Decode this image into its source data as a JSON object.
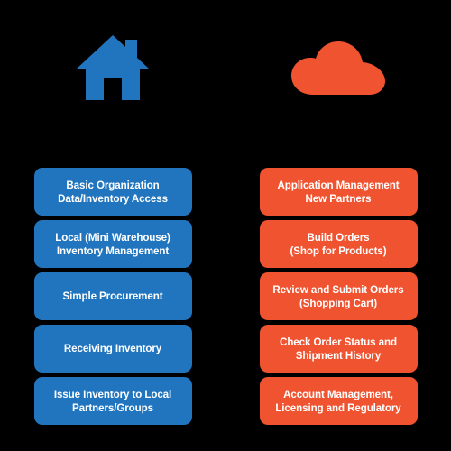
{
  "diagram": {
    "background_color": "#000000",
    "columns": [
      {
        "id": "local-column",
        "icon": "house-icon",
        "icon_color": "#2175bf",
        "box_color": "#2175bf",
        "text_color": "#ffffff",
        "boxes": [
          {
            "label": "Basic Organization\nData/Inventory Access"
          },
          {
            "label": "Local (Mini Warehouse)\nInventory Management"
          },
          {
            "label": "Simple Procurement"
          },
          {
            "label": "Receiving Inventory"
          },
          {
            "label": "Issue Inventory to Local\nPartners/Groups"
          }
        ]
      },
      {
        "id": "cloud-column",
        "icon": "cloud-icon",
        "icon_color": "#ef5330",
        "box_color": "#ef5330",
        "text_color": "#ffffff",
        "boxes": [
          {
            "label": "Application Management\nNew Partners"
          },
          {
            "label": "Build Orders\n(Shop for Products)"
          },
          {
            "label": "Review and Submit Orders\n(Shopping Cart)"
          },
          {
            "label": "Check Order Status and\nShipment History"
          },
          {
            "label": "Account Management,\nLicensing and Regulatory"
          }
        ]
      }
    ]
  }
}
